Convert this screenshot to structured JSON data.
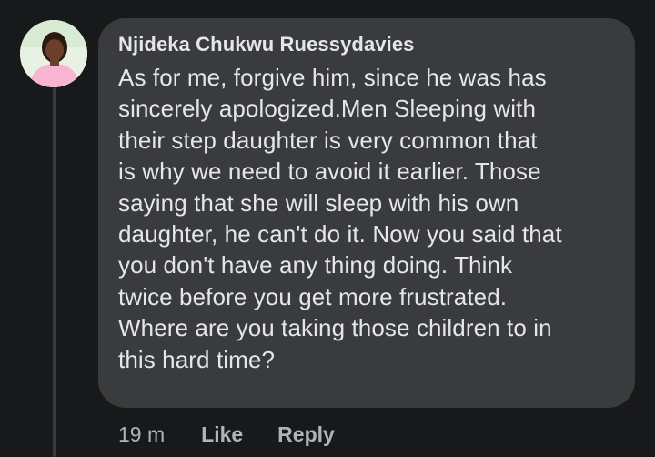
{
  "comment": {
    "author": "Njideka Chukwu Ruessydavies",
    "lines": [
      "As for me, forgive him, since he was has",
      "sincerely apologized.Men Sleeping with",
      "their step daughter is very common that",
      "is why we need to avoid it earlier. Those",
      "saying that she will sleep with his own",
      "daughter, he can't do it. Now you said that",
      "you don't have any thing doing. Think",
      "twice before you get more frustrated.",
      "Where are you taking those children to in",
      "this hard time?"
    ],
    "timestamp": "19 m",
    "like_label": "Like",
    "reply_label": "Reply"
  },
  "colors": {
    "background": "#18191a",
    "bubble": "#3a3b3c",
    "text": "#e4e6eb",
    "secondary_text": "#b0b3b8",
    "avatar_clothing": "#f7b5d2"
  },
  "icons": {
    "avatar": "profile-photo"
  }
}
